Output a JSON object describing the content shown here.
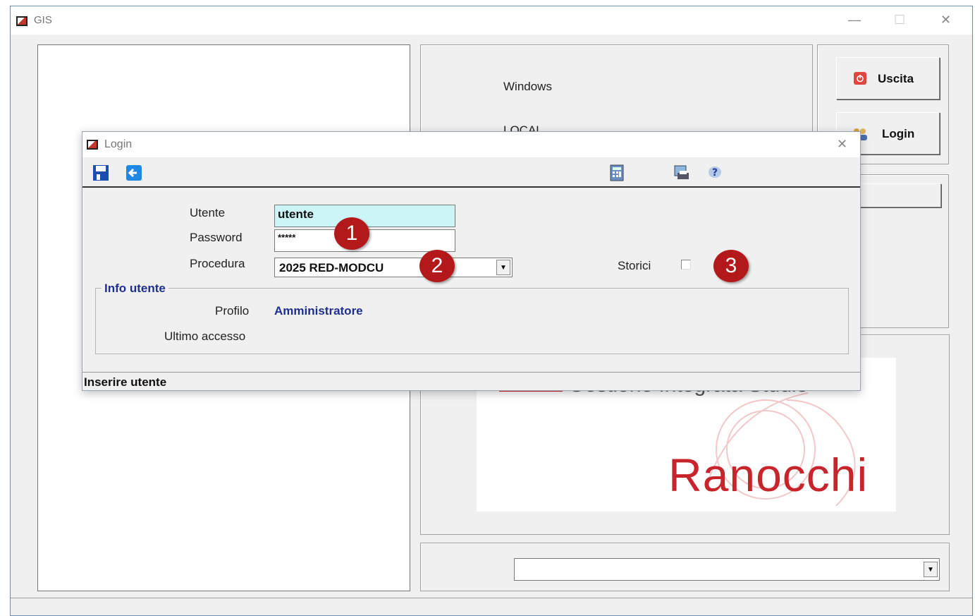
{
  "app": {
    "title": "GIS",
    "minimize_glyph": "—",
    "maximize_glyph": "☐",
    "close_glyph": "✕"
  },
  "info_panel": {
    "line1": "Windows",
    "line2": "LOCAL"
  },
  "buttons": {
    "exit_label": "Uscita",
    "login_label": "Login"
  },
  "logo": {
    "tagline": "Gestione Integrata Studio",
    "brand": "Ranocchi"
  },
  "login_dialog": {
    "title": "Login",
    "close_glyph": "✕",
    "fields": {
      "user_label": "Utente",
      "user_value": "utente",
      "password_label": "Password",
      "password_value": "*****",
      "procedure_label": "Procedura",
      "procedure_value": "2025 RED-MODCU",
      "history_label": "Storici"
    },
    "info_group": {
      "legend": "Info utente",
      "profile_label": "Profilo",
      "profile_value": "Amministratore",
      "last_access_label": "Ultimo accesso",
      "last_access_value": ""
    },
    "status_text": "Inserire utente"
  },
  "badges": [
    "1",
    "2",
    "3"
  ],
  "colors": {
    "badge": "#b3191b",
    "field_highlight": "#ccf5f7",
    "profile_value": "#1f2f8f",
    "brand_red": "#c8242b"
  },
  "icons": [
    "save-icon",
    "back-icon",
    "calculator-icon",
    "print-preview-icon",
    "help-icon",
    "exit-icon",
    "users-icon"
  ]
}
